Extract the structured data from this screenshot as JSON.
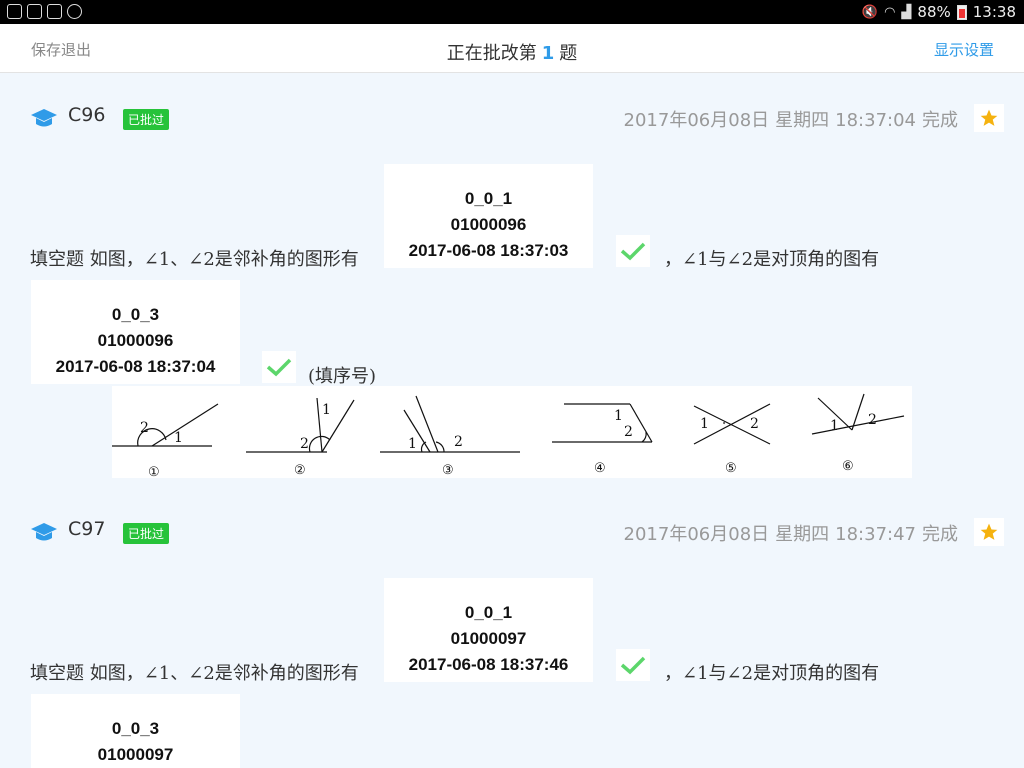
{
  "status_bar": {
    "battery": "88%",
    "time": "13:38"
  },
  "header": {
    "left_label": "保存退出",
    "title_prefix": "正在批改第",
    "title_number": "1",
    "title_suffix": "题",
    "right_label": "显示设置"
  },
  "records": [
    {
      "student": "C96",
      "badge": "已批过",
      "finish_date": "2017年06月08日",
      "finish_weekday": "星期四",
      "finish_time": "18:37:04",
      "finish_label": "完成",
      "question_prefix": "填空题  如图，∠1、∠2是邻补角的图形有",
      "question_middle": "，∠1与∠2是对顶角的图有",
      "hint": "(填序号)",
      "answer1": {
        "line1": "0_0_1",
        "line2": "01000096",
        "line3": "2017-06-08 18:37:03",
        "correct": true
      },
      "answer2": {
        "line1": "0_0_3",
        "line2": "01000096",
        "line3": "2017-06-08 18:37:04",
        "correct": true
      },
      "figure_labels": [
        "①",
        "②",
        "③",
        "④",
        "⑤",
        "⑥"
      ]
    },
    {
      "student": "C97",
      "badge": "已批过",
      "finish_date": "2017年06月08日",
      "finish_weekday": "星期四",
      "finish_time": "18:37:47",
      "finish_label": "完成",
      "question_prefix": "填空题  如图，∠1、∠2是邻补角的图形有",
      "question_middle": "，∠1与∠2是对顶角的图有",
      "answer1": {
        "line1": "0_0_1",
        "line2": "01000097",
        "line3": "2017-06-08 18:37:46",
        "correct": true
      },
      "answer2": {
        "line1": "0_0_3",
        "line2": "01000097"
      }
    }
  ],
  "colors": {
    "accent": "#2f9be8",
    "badge": "#27c33a",
    "check": "#5cd66b",
    "star": "#f5b20f"
  }
}
